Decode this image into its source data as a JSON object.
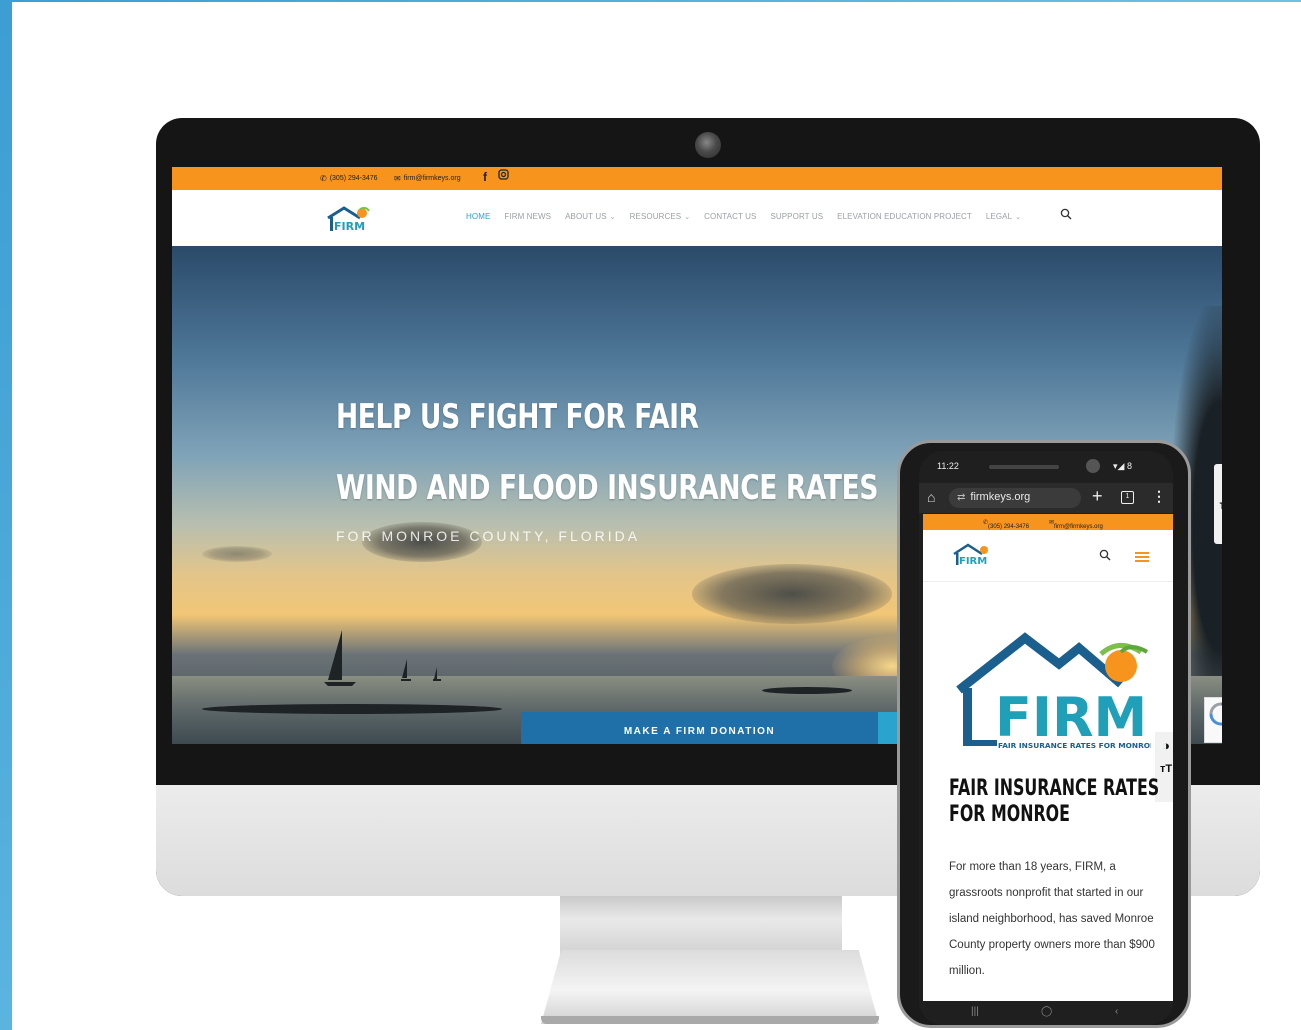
{
  "desktop": {
    "topbar": {
      "phone": "(305) 294-3476",
      "email": "firm@firmkeys.org"
    },
    "nav": {
      "logo_text": "FIRM",
      "items": [
        {
          "label": "HOME",
          "active": true,
          "dropdown": false
        },
        {
          "label": "FIRM NEWS",
          "active": false,
          "dropdown": false
        },
        {
          "label": "ABOUT US",
          "active": false,
          "dropdown": true
        },
        {
          "label": "RESOURCES",
          "active": false,
          "dropdown": true
        },
        {
          "label": "CONTACT US",
          "active": false,
          "dropdown": false
        },
        {
          "label": "SUPPORT US",
          "active": false,
          "dropdown": false
        },
        {
          "label": "ELEVATION EDUCATION PROJECT",
          "active": false,
          "dropdown": false
        },
        {
          "label": "LEGAL",
          "active": false,
          "dropdown": true
        }
      ]
    },
    "hero": {
      "title_line1": "HELP US FIGHT FOR FAIR",
      "title_line2": "WIND AND FLOOD INSURANCE RATES",
      "subtitle": "FOR MONROE COUNTY, FLORIDA",
      "cta": "MAKE A FIRM DONATION"
    },
    "a11y": {
      "contrast_icon": "◑",
      "text_size_icon": "тT"
    }
  },
  "mobile": {
    "status": {
      "time": "11:22",
      "right": "▾◢ 8"
    },
    "url": "firmkeys.org",
    "topbar": {
      "phone": "(305) 294-3476",
      "email": "firm@firmkeys.org"
    },
    "logo_text": "FIRM",
    "big_logo": {
      "text": "FIRM",
      "tagline": "FAIR INSURANCE RATES FOR MONROE"
    },
    "heading_line1": "FAIR INSURANCE RATES",
    "heading_line2": "FOR MONROE",
    "body": "For more than 18 years, FIRM, a grassroots nonprofit that started in our island neighborhood, has saved Monroe County property owners more than $900 million.",
    "a11y": {
      "contrast_icon": "◑",
      "text_size_icon": "тT"
    }
  },
  "colors": {
    "orange": "#f7941d",
    "nav_active": "#2aa2cf",
    "cta_blue": "#1f6fa9",
    "logo_blue": "#1a5f8e",
    "logo_teal": "#1fa0b8"
  }
}
